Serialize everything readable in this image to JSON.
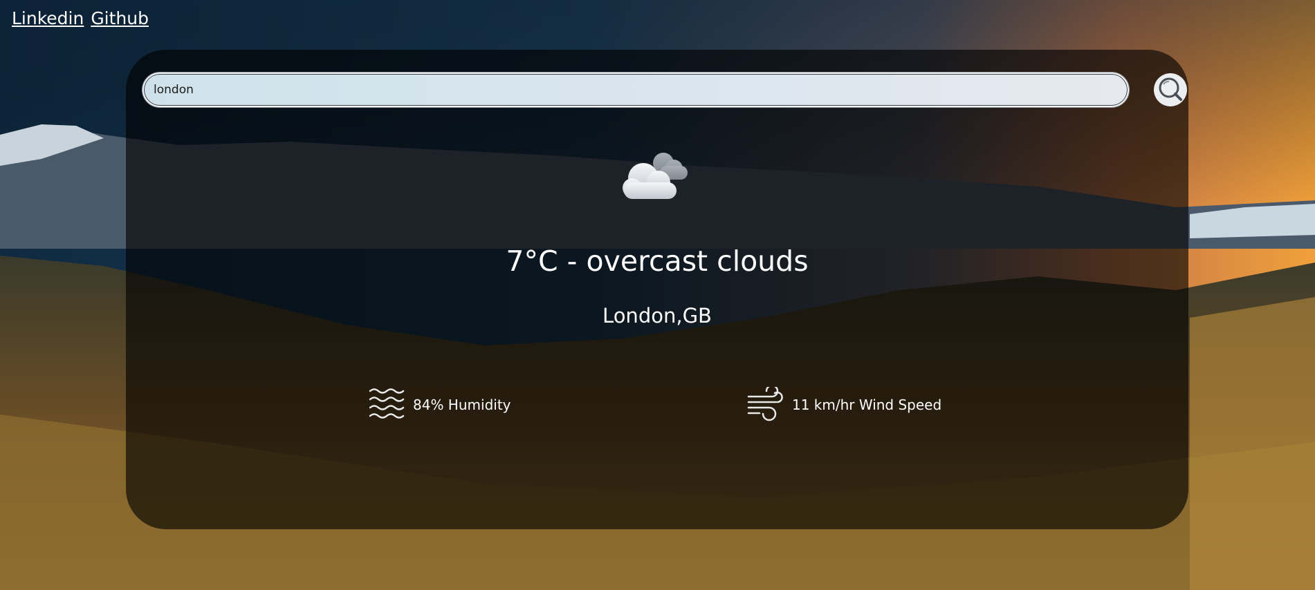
{
  "nav": {
    "links": [
      "Linkedin",
      "Github"
    ]
  },
  "search": {
    "value": "london",
    "button_icon": "search-icon"
  },
  "weather": {
    "icon": "cloud-icon",
    "summary": "7°C - overcast clouds",
    "location": "London,GB",
    "humidity": {
      "icon": "waves-icon",
      "text": "84% Humidity"
    },
    "wind": {
      "icon": "wind-icon",
      "text": "11 km/hr Wind Speed"
    }
  },
  "colors": {
    "card_overlay": "#000000",
    "text": "#ffffff",
    "input_bg": "#d6e5ee"
  }
}
